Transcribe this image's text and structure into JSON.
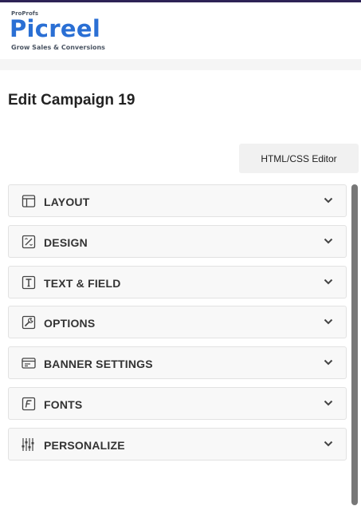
{
  "brand": {
    "company": "ProProfs",
    "name": "Picreel",
    "tagline": "Grow Sales & Conversions"
  },
  "page": {
    "title": "Edit Campaign 19"
  },
  "toolbar": {
    "html_css_editor_label": "HTML/CSS Editor"
  },
  "panels": [
    {
      "label": "LAYOUT",
      "icon": "layout-icon"
    },
    {
      "label": "DESIGN",
      "icon": "design-icon"
    },
    {
      "label": "TEXT & FIELD",
      "icon": "text-icon"
    },
    {
      "label": "OPTIONS",
      "icon": "wrench-icon"
    },
    {
      "label": "BANNER SETTINGS",
      "icon": "banner-icon"
    },
    {
      "label": "FONTS",
      "icon": "font-icon"
    },
    {
      "label": "PERSONALIZE",
      "icon": "sliders-icon"
    }
  ],
  "colors": {
    "brand_blue": "#2a6fd4",
    "top_bar": "#2d2356",
    "panel_bg": "#f8f8f8"
  }
}
